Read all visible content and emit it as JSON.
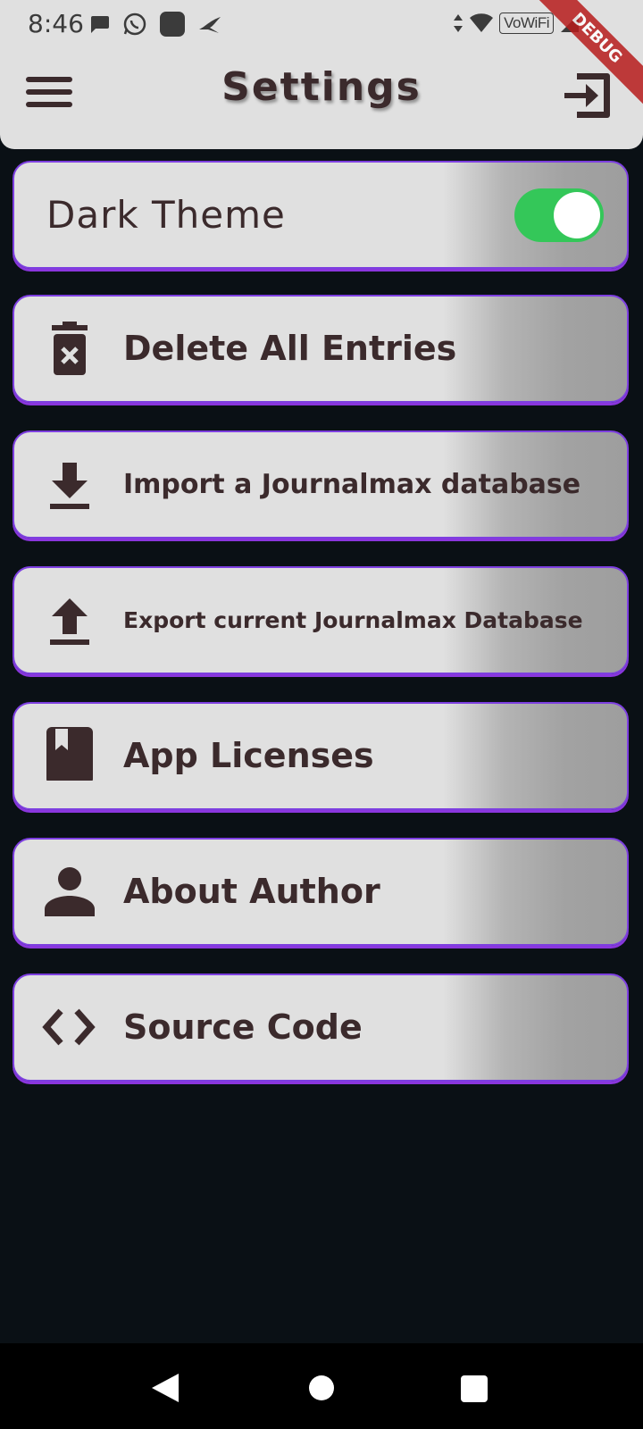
{
  "status_bar": {
    "time": "8:46",
    "wifi_label": "VoWiFi"
  },
  "debug_banner": "DEBUG",
  "header": {
    "title": "Settings"
  },
  "dark_theme": {
    "label": "Dark Theme",
    "enabled": true
  },
  "items": [
    {
      "label": "Delete All Entries",
      "icon": "delete-forever-icon"
    },
    {
      "label": "Import a Journalmax database",
      "icon": "download-icon"
    },
    {
      "label": "Export current Journalmax Database",
      "icon": "upload-icon"
    },
    {
      "label": "App Licenses",
      "icon": "book-icon"
    },
    {
      "label": "About Author",
      "icon": "person-icon"
    },
    {
      "label": "Source Code",
      "icon": "code-icon"
    }
  ],
  "colors": {
    "background": "#0a1015",
    "card": "#e0e0e0",
    "card_border": "#7d3fe0",
    "text": "#3b2a2c",
    "toggle_on": "#34c759"
  }
}
